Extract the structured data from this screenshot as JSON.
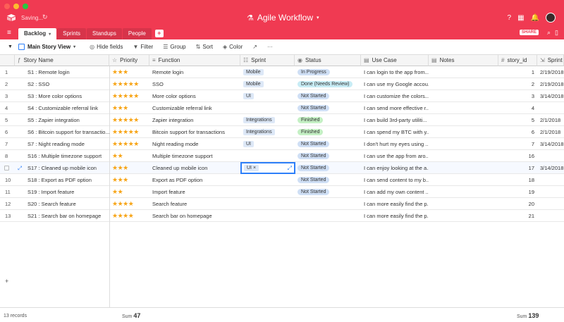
{
  "window": {
    "saving_text": "Saving...",
    "title": "Agile Workflow",
    "share_label": "SHARE"
  },
  "tabs": [
    {
      "label": "Backlog",
      "active": true
    },
    {
      "label": "Sprints",
      "active": false
    },
    {
      "label": "Standups",
      "active": false
    },
    {
      "label": "People",
      "active": false
    }
  ],
  "toolbar": {
    "view_name": "Main Story View",
    "hide_fields": "Hide fields",
    "filter": "Filter",
    "group": "Group",
    "sort": "Sort",
    "color": "Color"
  },
  "columns": {
    "story_name": "Story Name",
    "priority": "Priority",
    "function": "Function",
    "sprint": "Sprint",
    "status": "Status",
    "use_case": "Use Case",
    "notes": "Notes",
    "story_id": "story_id",
    "sprint_date": "Sprint R"
  },
  "rows": [
    {
      "num": "1",
      "name": "S1 : Remote login",
      "stars": 3,
      "function": "Remote login",
      "sprint": "Mobile",
      "status": "In Progress",
      "use_case": "I can login to the app from...",
      "story_id": "1",
      "date": "2/19/2018"
    },
    {
      "num": "2",
      "name": "S2 : SSO",
      "stars": 5,
      "function": "SSO",
      "sprint": "Mobile",
      "status": "Done (Needs Review)",
      "use_case": "I can use my Google accou...",
      "story_id": "2",
      "date": "2/19/2018"
    },
    {
      "num": "3",
      "name": "S3 : More color options",
      "stars": 5,
      "function": "More color options",
      "sprint": "UI",
      "status": "Not Started",
      "use_case": "I can customize the colors...",
      "story_id": "3",
      "date": "3/14/2018"
    },
    {
      "num": "4",
      "name": "S4 : Customizable referral link",
      "stars": 3,
      "function": "Customizable referral link",
      "sprint": "",
      "status": "Not Started",
      "use_case": "I can send more effective r...",
      "story_id": "4",
      "date": ""
    },
    {
      "num": "5",
      "name": "S5 : Zapier integration",
      "stars": 5,
      "function": "Zapier integration",
      "sprint": "Integrations",
      "status": "Finished",
      "use_case": "I can build 3rd-party utiliti...",
      "story_id": "5",
      "date": "2/1/2018"
    },
    {
      "num": "6",
      "name": "S6 : Bitcoin support for transactio...",
      "stars": 5,
      "function": "Bitcoin support for transactions",
      "sprint": "Integrations",
      "status": "Finished",
      "use_case": "I can spend my BTC with y...",
      "story_id": "6",
      "date": "2/1/2018"
    },
    {
      "num": "7",
      "name": "S7 : Night reading mode",
      "stars": 5,
      "function": "Night reading mode",
      "sprint": "UI",
      "status": "Not Started",
      "use_case": "I don't hurt my eyes using ...",
      "story_id": "7",
      "date": "3/14/2018"
    },
    {
      "num": "8",
      "name": "S16 : Multiple timezone support",
      "stars": 2,
      "function": "Multiple timezone support",
      "sprint": "",
      "status": "Not Started",
      "use_case": "I can use the app from aro...",
      "story_id": "16",
      "date": ""
    },
    {
      "num": "",
      "name": "S17 : Cleaned up mobile icon",
      "stars": 3,
      "function": "Cleaned up mobile icon",
      "sprint": "UI",
      "status": "Not Started",
      "use_case": "I can enjoy looking at the a...",
      "story_id": "17",
      "date": "3/14/2018"
    },
    {
      "num": "10",
      "name": "S18 : Export as PDF option",
      "stars": 3,
      "function": "Export as PDF option",
      "sprint": "",
      "status": "Not Started",
      "use_case": "I can send content to my b...",
      "story_id": "18",
      "date": ""
    },
    {
      "num": "11",
      "name": "S19 : Import feature",
      "stars": 2,
      "function": "Import feature",
      "sprint": "",
      "status": "Not Started",
      "use_case": "I can add my own content ...",
      "story_id": "19",
      "date": ""
    },
    {
      "num": "12",
      "name": "S20 : Search feature",
      "stars": 4,
      "function": "Search feature",
      "sprint": "",
      "status": "",
      "use_case": "I can more easily find the p...",
      "story_id": "20",
      "date": ""
    },
    {
      "num": "13",
      "name": "S21 : Search bar on homepage",
      "stars": 4,
      "function": "Search bar on homepage",
      "sprint": "",
      "status": "",
      "use_case": "I can more easily find the p...",
      "story_id": "21",
      "date": ""
    }
  ],
  "footer": {
    "records": "13 records",
    "sum_label": "Sum",
    "priority_sum": "47",
    "story_id_sum": "139"
  },
  "colors": {
    "brand": "#f03a52",
    "star": "#f7a415",
    "selection": "#2d7ff9"
  }
}
